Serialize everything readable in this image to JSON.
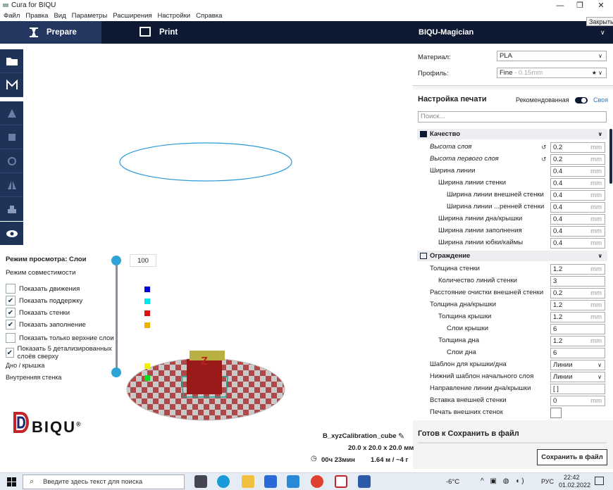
{
  "window": {
    "title": "Cura for BIQU",
    "min": "—",
    "restore": "❐",
    "close": "✕",
    "close_tooltip": "Закрыть"
  },
  "menu": [
    "Файл",
    "Правка",
    "Вид",
    "Параметры",
    "Расширения",
    "Настройки",
    "Справка"
  ],
  "header": {
    "prepare": "Prepare",
    "print": "Print",
    "printer": "BIQU-Magician"
  },
  "view_panel": {
    "title": "Режим просмотра: Слои",
    "compat": "Режим совместимости",
    "options": [
      {
        "label": "Показать движения",
        "checked": false,
        "color": "#0000e0"
      },
      {
        "label": "Показать поддержку",
        "checked": true,
        "color": "#00e6f0"
      },
      {
        "label": "Показать стенки",
        "checked": true,
        "color": "#e01010"
      },
      {
        "label": "Показать заполнение",
        "checked": true,
        "color": "#f0b000"
      },
      {
        "label": "Показать только верхние слои",
        "checked": false
      },
      {
        "label": "Показать 5 детализированных слоёв сверху",
        "checked": true
      }
    ],
    "legend": [
      {
        "label": "Дно / крышка",
        "color": "#f0f000"
      },
      {
        "label": "Внутренняя стенка",
        "color": "#00e020"
      }
    ],
    "layer_value": "100",
    "check_mark": "✔"
  },
  "material": {
    "label": "Материал:",
    "value": "PLA"
  },
  "profile": {
    "label": "Профиль:",
    "value": "Fine",
    "suffix": " - 0.15mm"
  },
  "settings": {
    "title": "Настройка печати",
    "recommended": "Рекомендованная",
    "custom": "Своя",
    "search_placeholder": "Поиск...",
    "sections": [
      {
        "name": "Качество",
        "rows": [
          {
            "label": "Высота слоя",
            "value": "0.2",
            "unit": "mm",
            "indent": 0,
            "italic": true,
            "reset": true
          },
          {
            "label": "Высота первого слоя",
            "value": "0.2",
            "unit": "mm",
            "indent": 0,
            "italic": true,
            "reset": true
          },
          {
            "label": "Ширина линии",
            "value": "0.4",
            "unit": "mm",
            "indent": 0
          },
          {
            "label": "Ширина линии стенки",
            "value": "0.4",
            "unit": "mm",
            "indent": 1
          },
          {
            "label": "Ширина линии внешней стенки",
            "value": "0.4",
            "unit": "mm",
            "indent": 2
          },
          {
            "label": "Ширина линии ...ренней стенки",
            "value": "0.4",
            "unit": "mm",
            "indent": 2
          },
          {
            "label": "Ширина линии дна/крышки",
            "value": "0.4",
            "unit": "mm",
            "indent": 1
          },
          {
            "label": "Ширина линии заполнения",
            "value": "0.4",
            "unit": "mm",
            "indent": 1
          },
          {
            "label": "Ширина линии юбки/каймы",
            "value": "0.4",
            "unit": "mm",
            "indent": 1
          }
        ]
      },
      {
        "name": "Ограждение",
        "rows": [
          {
            "label": "Толщина стенки",
            "value": "1.2",
            "unit": "mm",
            "indent": 0
          },
          {
            "label": "Количество линий стенки",
            "value": "3",
            "unit": "",
            "indent": 1
          },
          {
            "label": "Расстояние очистки внешней стенки",
            "value": "0.2",
            "unit": "mm",
            "indent": 0
          },
          {
            "label": "Толщина дна/крышки",
            "value": "1.2",
            "unit": "mm",
            "indent": 0
          },
          {
            "label": "Толщина крышки",
            "value": "1.2",
            "unit": "mm",
            "indent": 1
          },
          {
            "label": "Слои крышки",
            "value": "6",
            "unit": "",
            "indent": 2
          },
          {
            "label": "Толщина дна",
            "value": "1.2",
            "unit": "mm",
            "indent": 1
          },
          {
            "label": "Слои дна",
            "value": "6",
            "unit": "",
            "indent": 2
          },
          {
            "label": "Шаблон для крышки/дна",
            "value": "Линии",
            "dropdown": true,
            "indent": 0
          },
          {
            "label": "Нижний шаблон начального слоя",
            "value": "Линии",
            "dropdown": true,
            "indent": 0
          },
          {
            "label": "Направление линии дна/крышки",
            "value": "[ ]",
            "unit": "",
            "indent": 0
          },
          {
            "label": "Вставка внешней стенки",
            "value": "0",
            "unit": "mm",
            "indent": 0
          },
          {
            "label": "Печать внешних стенок",
            "checkbox": true,
            "indent": 0
          }
        ]
      }
    ]
  },
  "save": {
    "title": "Готов к Сохранить в файл",
    "button": "Сохранить в файл"
  },
  "object": {
    "name": "B_xyzCalibration_cube",
    "dims": "20.0 x 20.0 x 20.0 мм",
    "time": "00ч 23мин",
    "material": "1.64 м / ~4 г"
  },
  "logo": {
    "text": "BIQU",
    "reg": "®"
  },
  "taskbar": {
    "search": "Введите здесь текст для поиска",
    "weather": "-6°C",
    "lang": "РУС",
    "time": "22:42",
    "date": "01.02.2022"
  }
}
